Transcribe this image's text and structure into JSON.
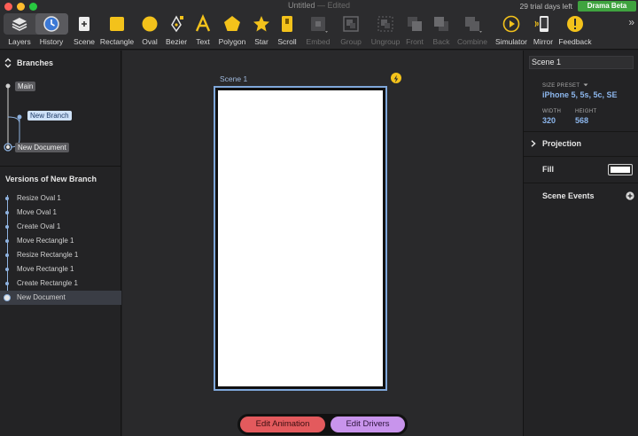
{
  "window": {
    "title": "Untitled",
    "edited": " — Edited",
    "trial_text": "29 trial days left",
    "badge": "Drama Beta"
  },
  "toolbar": {
    "layers": "Layers",
    "history": "History",
    "scene": "Scene",
    "rectangle": "Rectangle",
    "oval": "Oval",
    "bezier": "Bezier",
    "text": "Text",
    "polygon": "Polygon",
    "star": "Star",
    "scroll": "Scroll",
    "embed": "Embed",
    "group": "Group",
    "ungroup": "Ungroup",
    "front": "Front",
    "back": "Back",
    "combine": "Combine",
    "simulator": "Simulator",
    "mirror": "Mirror",
    "feedback": "Feedback",
    "more": "»"
  },
  "branches": {
    "title": "Branches",
    "main": "Main",
    "new_branch": "New Branch",
    "new_document": "New Document"
  },
  "versions": {
    "title": "Versions of New Branch",
    "items": [
      "Resize Oval 1",
      "Move Oval 1",
      "Create Oval 1",
      "Move Rectangle 1",
      "Resize Rectangle 1",
      "Move Rectangle 1",
      "Create Rectangle 1",
      "New Document"
    ]
  },
  "canvas": {
    "scene_label": "Scene 1",
    "edit_animation": "Edit Animation",
    "edit_drivers": "Edit Drivers"
  },
  "inspector": {
    "name_value": "Scene 1",
    "size_preset_label": "SIZE PRESET",
    "size_preset_value": "iPhone 5, 5s, 5c, SE",
    "width_label": "WIDTH",
    "width_value": "320",
    "height_label": "HEIGHT",
    "height_value": "568",
    "projection": "Projection",
    "fill": "Fill",
    "scene_events": "Scene Events"
  },
  "colors": {
    "accent_blue": "#8cb6ec",
    "badge_green": "#3fa33f",
    "edit_animation": "#e35a5d",
    "edit_drivers": "#c894ec",
    "bolt": "#f3c21b"
  }
}
